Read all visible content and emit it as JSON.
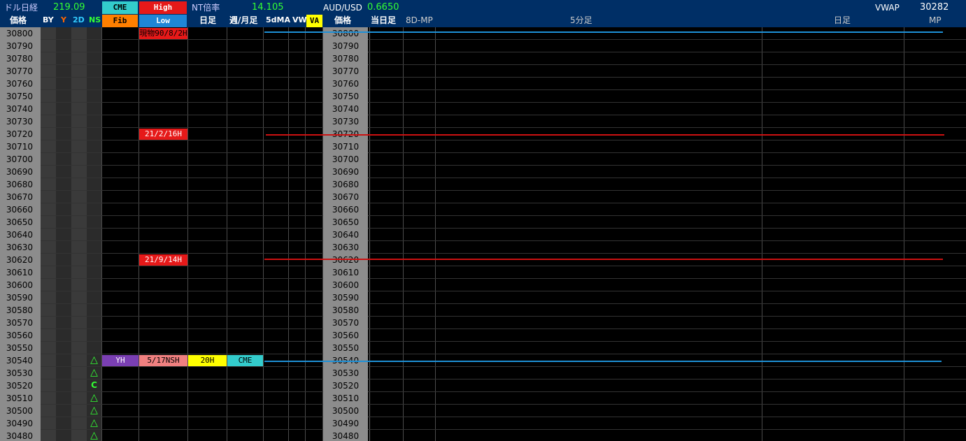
{
  "header": {
    "row1": {
      "dollar_nikkei_label": "ドル日経",
      "dollar_nikkei_value": "219.09",
      "cme": "CME",
      "high": "High",
      "nt_ratio_label": "NT倍率",
      "nt_ratio_value": "14.105",
      "audusd_label": "AUD/USD",
      "audusd_value": "0.6650",
      "vwap_label": "VWAP",
      "vwap_value": "30282"
    },
    "row2": {
      "price": "価格",
      "by": "BY",
      "y": "Y",
      "two_d": "2D",
      "ns": "NS",
      "fib": "Fib",
      "low": "Low",
      "daily": "日足",
      "weekly_monthly": "週/月足",
      "ma5d": "5dMA",
      "vw": "VW",
      "va": "VA",
      "price2": "価格",
      "today": "当日足",
      "mp8d": "8D-MP",
      "five_min": "5分足",
      "daily2": "日足",
      "mp": "MP"
    }
  },
  "prices": [
    "30800",
    "30790",
    "30780",
    "30770",
    "30760",
    "30750",
    "30740",
    "30730",
    "30720",
    "30710",
    "30700",
    "30690",
    "30680",
    "30670",
    "30660",
    "30650",
    "30640",
    "30630",
    "30620",
    "30610",
    "30600",
    "30590",
    "30580",
    "30570",
    "30560",
    "30550",
    "30540",
    "30530",
    "30520",
    "30510",
    "30500",
    "30490",
    "30480"
  ],
  "labels": {
    "label_30800": "現物90/8/2H",
    "label_30720": "21/2/16H",
    "label_30620": "21/9/14H",
    "yh": "YH",
    "nsh": "5/17NSH",
    "h20": "20H",
    "cme_level": "CME"
  },
  "ns_markers": [
    "△",
    "△",
    "C",
    "△",
    "△",
    "△",
    "△"
  ],
  "colors": {
    "header_bg": "#002f66",
    "price_col_bg": "#8c8c8c",
    "cyan": "#33cccc",
    "red": "#e61919",
    "blue_low": "#1f86d6",
    "orange": "#ff7f00",
    "green_text": "#33ff33",
    "yellow": "#ffff00",
    "purple": "#7a3fb3",
    "pink": "#f08080",
    "level_line_blue": "#1e90d6",
    "level_line_red": "#cc1111"
  }
}
